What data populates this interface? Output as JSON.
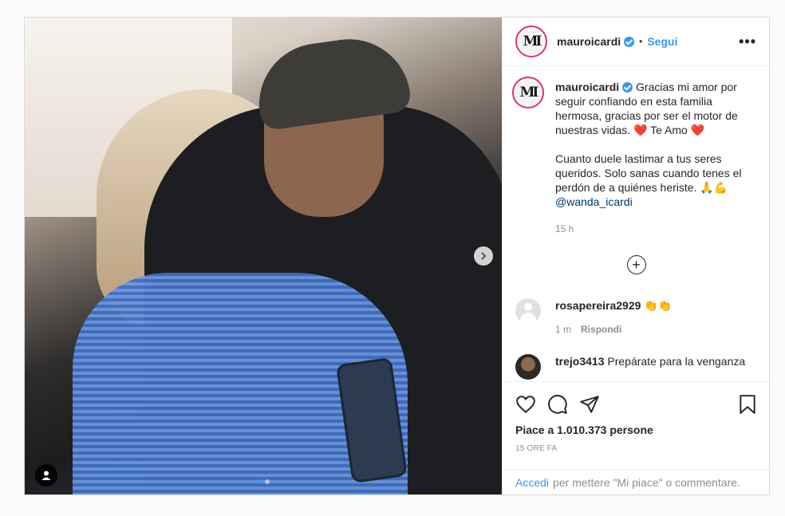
{
  "post": {
    "author": "mauroicardi",
    "follow_label": "Segui",
    "separator": "•",
    "more_label": "•••",
    "avatar_text": "MI"
  },
  "caption": {
    "user": "mauroicardi",
    "line1": "Gracias mi amor por seguir confiando en esta familia hermosa, gracias por ser el motor de nuestras vidas. ❤️ Te Amo ❤️",
    "line2": "Cuanto duele lastimar a tus seres queridos. Solo sanas cuando tenes el perdón de a quiénes heriste. 🙏💪",
    "mention": "@wanda_icardi",
    "time": "15 h"
  },
  "load_more_icon": "+",
  "comments": [
    {
      "user": "rosapereira2929",
      "text": "👏👏",
      "time": "1 m",
      "reply": "Rispondi"
    },
    {
      "user": "trejo3413",
      "text": "Prepárate para la venganza"
    }
  ],
  "likes": "Piace a 1.010.373 persone",
  "timestamp": "15 ORE FA",
  "login": {
    "link": "Accedi",
    "text": "per mettere \"Mi piace\" o commentare."
  },
  "colors": {
    "accent": "#3897f0",
    "muted": "#8e8e8e",
    "story_ring": "#e1306c"
  },
  "icons": [
    "heart-icon",
    "comment-icon",
    "share-icon",
    "bookmark-icon",
    "chevron-right-icon",
    "user-tag-icon",
    "plus-circle-icon",
    "verified-icon",
    "more-icon"
  ]
}
